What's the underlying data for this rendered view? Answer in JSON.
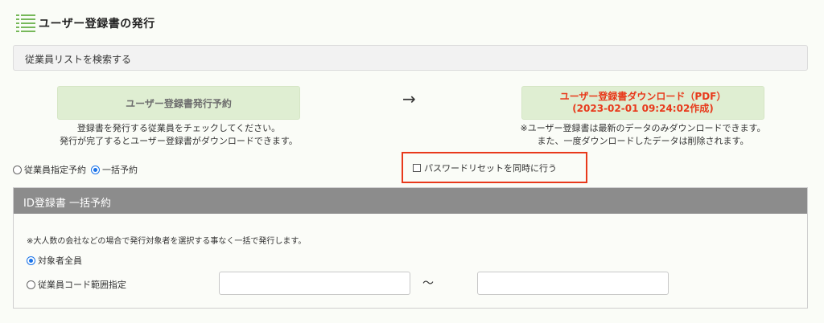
{
  "page": {
    "title": "ユーザー登録書の発行"
  },
  "search": {
    "label": "従業員リストを検索する"
  },
  "actions": {
    "reserve_label": "ユーザー登録書発行予約",
    "reserve_note_line1": "登録書を発行する従業員をチェックしてください。",
    "reserve_note_line2": "発行が完了するとユーザー登録書がダウンロードできます。",
    "arrow": "→",
    "download_label": "ユーザー登録書ダウンロード（PDF）",
    "download_created": "(2023-02-01 09:24:02作成)",
    "download_note_line1": "※ユーザー登録書は最新のデータのみダウンロードできます。",
    "download_note_line2": "また、一度ダウンロードしたデータは削除されます。"
  },
  "mode": {
    "options": [
      "従業員指定予約",
      "一括予約"
    ],
    "selected": "一括予約"
  },
  "password_reset": {
    "label": "パスワードリセットを同時に行う",
    "checked": false
  },
  "bulk_panel": {
    "title": "ID登録書 一括予約",
    "note": "※大人数の会社などの場合で発行対象者を選択する事なく一括で発行します。",
    "option_all": "対象者全員",
    "option_range": "従業員コード範囲指定",
    "selected": "対象者全員",
    "range_from": "",
    "range_to": "",
    "tilde": "〜"
  },
  "colors": {
    "accent_green": "#77b85a",
    "button_green": "#dfeed2",
    "alert_red": "#e8391b",
    "panel_header": "#8c8c8c",
    "radio_blue": "#1a73e8"
  }
}
